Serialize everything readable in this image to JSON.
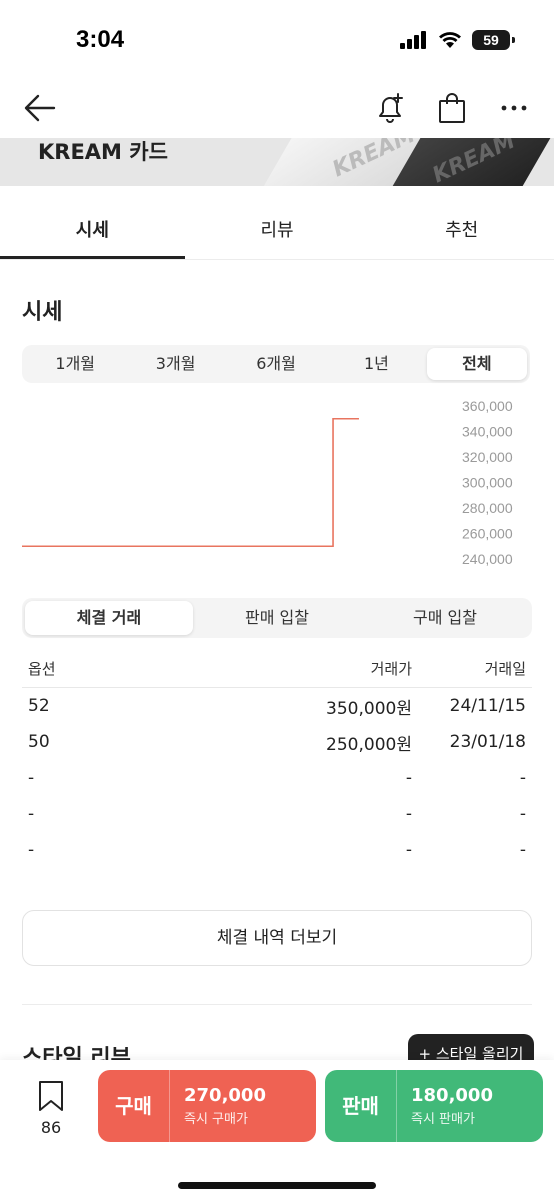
{
  "status": {
    "time": "3:04",
    "battery": "59"
  },
  "nav": {
    "back_icon": "arrow-left-icon",
    "bell_icon": "bell-plus-icon",
    "bag_icon": "shopping-bag-icon",
    "more_icon": "more-horizontal-icon"
  },
  "banner": {
    "title": "KREAM 카드",
    "card_text_1": "KREAM",
    "card_text_2": "KREAM"
  },
  "tabs": [
    {
      "label": "시세",
      "active": true
    },
    {
      "label": "리뷰",
      "active": false
    },
    {
      "label": "추천",
      "active": false
    }
  ],
  "market": {
    "title": "시세",
    "periods": [
      {
        "label": "1개월",
        "active": false
      },
      {
        "label": "3개월",
        "active": false
      },
      {
        "label": "6개월",
        "active": false
      },
      {
        "label": "1년",
        "active": false
      },
      {
        "label": "전체",
        "active": true
      }
    ]
  },
  "chart_data": {
    "type": "line",
    "title": "",
    "xlabel": "",
    "ylabel": "",
    "y_ticks": [
      "360,000",
      "340,000",
      "320,000",
      "300,000",
      "280,000",
      "260,000",
      "240,000"
    ],
    "ylim": [
      240000,
      360000
    ],
    "series": [
      {
        "values": [
          250000,
          250000,
          350000,
          350000
        ]
      }
    ],
    "x_fraction": [
      0,
      0.72,
      0.72,
      0.78
    ],
    "line_color": "#e8745f"
  },
  "trades": {
    "tabs": [
      {
        "label": "체결 거래",
        "active": true
      },
      {
        "label": "판매 입찰",
        "active": false
      },
      {
        "label": "구매 입찰",
        "active": false
      }
    ],
    "headers": {
      "option": "옵션",
      "price": "거래가",
      "date": "거래일"
    },
    "rows": [
      {
        "option": "52",
        "price": "350,000원",
        "date": "24/11/15"
      },
      {
        "option": "50",
        "price": "250,000원",
        "date": "23/01/18"
      },
      {
        "option": "-",
        "price": "-",
        "date": "-"
      },
      {
        "option": "-",
        "price": "-",
        "date": "-"
      },
      {
        "option": "-",
        "price": "-",
        "date": "-"
      }
    ],
    "more_label": "체결 내역 더보기"
  },
  "style_review": {
    "title": "스타일 리뷰",
    "upload_label": "+ 스타일 올리기"
  },
  "bottom": {
    "bookmark_count": "86",
    "buy": {
      "label": "구매",
      "price": "270,000",
      "sub": "즉시 구매가",
      "color": "#ef6253"
    },
    "sell": {
      "label": "판매",
      "price": "180,000",
      "sub": "즉시 판매가",
      "color": "#41b979"
    }
  }
}
